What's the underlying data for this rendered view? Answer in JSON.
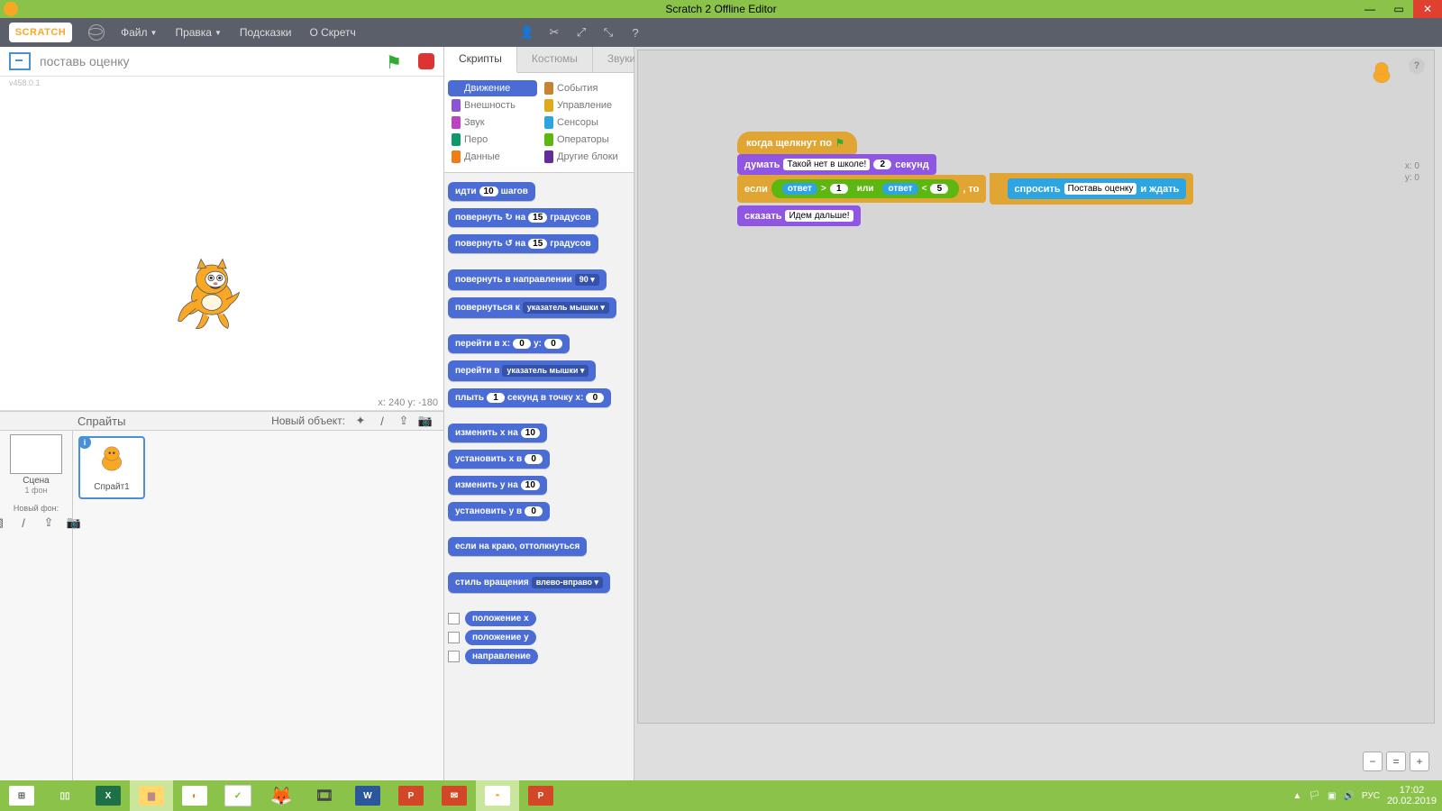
{
  "window": {
    "title": "Scratch 2 Offline Editor",
    "min": "—",
    "max": "▭",
    "close": "✕"
  },
  "menu": {
    "logo": "SCRATCH",
    "items": [
      "Файл",
      "Правка",
      "Подсказки",
      "О Скретч"
    ],
    "dropdown": [
      true,
      true,
      false,
      false
    ]
  },
  "stage": {
    "project_title": "поставь оценку",
    "version": "v458.0.1",
    "coords": "x: 240  y: -180"
  },
  "sprites": {
    "label": "Спрайты",
    "new_label": "Новый объект:",
    "scene": "Сцена",
    "scene_sub": "1 фон",
    "new_bg": "Новый фон:",
    "sprite1": "Спрайт1",
    "info": "i"
  },
  "tabs": [
    "Скрипты",
    "Костюмы",
    "Звуки"
  ],
  "categories": [
    {
      "name": "Движение",
      "color": "#4a6cd4",
      "sel": true
    },
    {
      "name": "События",
      "color": "#c88330"
    },
    {
      "name": "Внешность",
      "color": "#8a55d7"
    },
    {
      "name": "Управление",
      "color": "#e1a91a"
    },
    {
      "name": "Звук",
      "color": "#bb42c3"
    },
    {
      "name": "Сенсоры",
      "color": "#2ca5e2"
    },
    {
      "name": "Перо",
      "color": "#0e9a6c"
    },
    {
      "name": "Операторы",
      "color": "#5cb712"
    },
    {
      "name": "Данные",
      "color": "#ee7d16"
    },
    {
      "name": "Другие блоки",
      "color": "#632d99"
    }
  ],
  "palette": {
    "b1": {
      "t1": "идти",
      "n": "10",
      "t2": "шагов"
    },
    "b2": {
      "t1": "повернуть ↻ на",
      "n": "15",
      "t2": "градусов"
    },
    "b3": {
      "t1": "повернуть ↺ на",
      "n": "15",
      "t2": "градусов"
    },
    "b4": {
      "t1": "повернуть в направлении",
      "d": "90 ▾"
    },
    "b5": {
      "t1": "повернуться к",
      "d": "указатель мышки ▾"
    },
    "b6": {
      "t1": "перейти в x:",
      "n1": "0",
      "t2": "y:",
      "n2": "0"
    },
    "b7": {
      "t1": "перейти в",
      "d": "указатель мышки ▾"
    },
    "b8": {
      "t1": "плыть",
      "n1": "1",
      "t2": "секунд в точку x:",
      "n2": "0",
      "t3": ""
    },
    "b9": {
      "t1": "изменить x на",
      "n": "10"
    },
    "b10": {
      "t1": "установить x в",
      "n": "0"
    },
    "b11": {
      "t1": "изменить y на",
      "n": "10"
    },
    "b12": {
      "t1": "установить y в",
      "n": "0"
    },
    "b13": {
      "t": "если на краю, оттолкнуться"
    },
    "b14": {
      "t1": "стиль вращения",
      "d": "влево-вправо ▾"
    },
    "v1": "положение x",
    "v2": "положение y",
    "v3": "направление"
  },
  "script": {
    "hat": "когда щелкнут по",
    "think": {
      "l": "думать",
      "txt": "Такой нет в школе!",
      "n": "2",
      "r": "секунд"
    },
    "if": {
      "l": "если",
      "ans": "ответ",
      "gt": ">",
      "v1": "1",
      "or": "или",
      "lt": "<",
      "v2": "5",
      "then": ", то"
    },
    "ask": {
      "l": "спросить",
      "txt": "Поставь оценку",
      "r": "и ждать"
    },
    "say": {
      "l": "сказать",
      "txt": "Идем дальше!"
    }
  },
  "canvas": {
    "x": "x: 0",
    "y": "y: 0",
    "help": "?"
  },
  "taskbar": {
    "apps": [
      {
        "nm": "start",
        "bg": "#fff",
        "fg": "#666",
        "txt": "⊞"
      },
      {
        "nm": "taskview",
        "bg": "transparent",
        "fg": "#fff",
        "txt": "▭▭"
      },
      {
        "nm": "excel",
        "bg": "#1e7145",
        "fg": "#fff",
        "txt": "X"
      },
      {
        "nm": "explorer",
        "bg": "#ffd76a",
        "fg": "#8a6",
        "txt": "▅"
      },
      {
        "nm": "blender",
        "bg": "#e87d0d",
        "fg": "#fff",
        "txt": "◐"
      },
      {
        "nm": "onenote",
        "bg": "#fff",
        "fg": "#7b2",
        "txt": "✓"
      },
      {
        "nm": "firefox",
        "bg": "#ff9500",
        "fg": "#039",
        "txt": "◉"
      },
      {
        "nm": "mediaplayer",
        "bg": "#666",
        "fg": "#ffcc00",
        "txt": "✿"
      },
      {
        "nm": "word",
        "bg": "#2b579a",
        "fg": "#fff",
        "txt": "W"
      },
      {
        "nm": "powerpoint1",
        "bg": "#d24726",
        "fg": "#fff",
        "txt": "P"
      },
      {
        "nm": "mail",
        "bg": "#d24726",
        "fg": "#fff",
        "txt": "✉"
      },
      {
        "nm": "scratch",
        "bg": "#fff",
        "fg": "#f9a825",
        "txt": "◓"
      },
      {
        "nm": "powerpoint2",
        "bg": "#d24726",
        "fg": "#fff",
        "txt": "P"
      }
    ],
    "tray": {
      "lang": "РУС",
      "up": "▲",
      "time": "17:02",
      "date": "20.02.2019"
    }
  }
}
